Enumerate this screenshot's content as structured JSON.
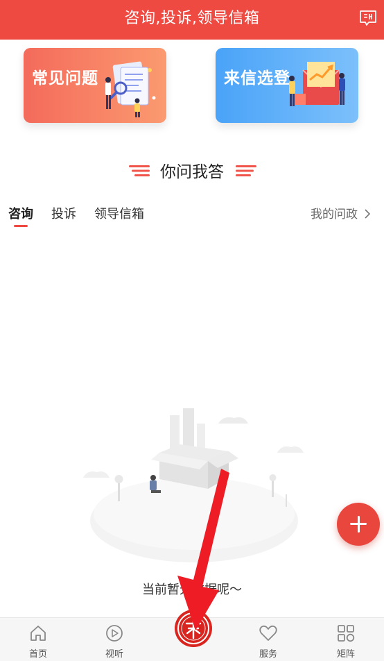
{
  "header": {
    "title": "咨询,投诉,领导信箱",
    "icon": "news-tag-icon"
  },
  "cards": [
    {
      "label": "常见问题",
      "color": "#f46b5b"
    },
    {
      "label": "来信选登",
      "color": "#4aa3f8"
    }
  ],
  "section_title": "你问我答",
  "tabs": [
    {
      "label": "咨询",
      "active": true
    },
    {
      "label": "投诉",
      "active": false
    },
    {
      "label": "领导信箱",
      "active": false
    }
  ],
  "mine_link": "我的问政",
  "empty_text": "当前暂无数据呢～",
  "fab_icon": "plus-icon",
  "bottom_nav": [
    {
      "label": "首页",
      "icon": "home-icon"
    },
    {
      "label": "视听",
      "icon": "play-icon"
    },
    {
      "label": "",
      "icon": "center-logo-icon"
    },
    {
      "label": "服务",
      "icon": "heart-icon"
    },
    {
      "label": "矩阵",
      "icon": "grid-icon"
    }
  ],
  "colors": {
    "accent": "#ee4a42",
    "annotation_arrow": "#ee1c25"
  }
}
